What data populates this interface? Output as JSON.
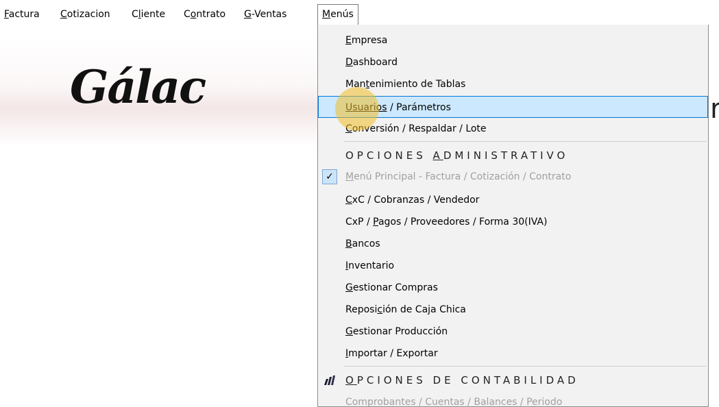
{
  "menubar": {
    "items": [
      {
        "accel": "F",
        "rest": "actura"
      },
      {
        "accel": "C",
        "rest": "otizacion"
      },
      {
        "pre": "C",
        "accel": "l",
        "rest": "iente"
      },
      {
        "pre": "C",
        "accel": "o",
        "rest": "ntrato"
      },
      {
        "accel": "G",
        "rest": "-Ventas"
      },
      {
        "accel": "M",
        "rest": "enús"
      }
    ]
  },
  "logo": {
    "text": "Gálac",
    "right_fragment": "r"
  },
  "menu": {
    "empresa": {
      "accel": "E",
      "rest": "mpresa"
    },
    "dashboard": {
      "accel": "D",
      "rest": "ashboard"
    },
    "mantenimiento": {
      "pre": "Man",
      "accel": "t",
      "rest": "enimiento de Tablas"
    },
    "usuarios": {
      "accel": "U",
      "mid": "suarios",
      "rest": " / Parámetros"
    },
    "conversion": {
      "accel": "C",
      "rest": "onversión / Respaldar / Lote"
    },
    "opciones_admin": {
      "pre": "OPCIONES ",
      "accel": "A",
      "rest": "DMINISTRATIVO"
    },
    "menu_principal": {
      "accel": "M",
      "rest": "enú Principal - Factura / Cotización / Contrato",
      "checked": true
    },
    "cxc": {
      "accel": "C",
      "rest": "xC / Cobranzas / Vendedor"
    },
    "cxp": {
      "pre": "CxP / ",
      "accel": "P",
      "rest": "agos / Proveedores / Forma 30(IVA)"
    },
    "bancos": {
      "accel": "B",
      "rest": "ancos"
    },
    "inventario": {
      "accel": "I",
      "rest": "nventario"
    },
    "compras": {
      "accel": "G",
      "rest": "estionar Compras"
    },
    "caja_chica": {
      "pre": "Reposi",
      "accel": "c",
      "rest": "ión de Caja Chica"
    },
    "produccion": {
      "accel": "G",
      "rest": "estionar Producción"
    },
    "importar": {
      "accel": "I",
      "rest": "mportar / Exportar"
    },
    "opciones_contab": {
      "accel": "O",
      "rest": "PCIONES DE CONTABILIDAD"
    },
    "comprobantes": {
      "text": "Comprobantes / Cuentas / Balances / Periodo"
    }
  },
  "icons": {
    "check": "check-icon",
    "accounting": "accounting-bars-icon"
  },
  "colors": {
    "highlight": "#cce8ff",
    "highlight_border": "#0078d7",
    "cursor": "#f0be28"
  }
}
